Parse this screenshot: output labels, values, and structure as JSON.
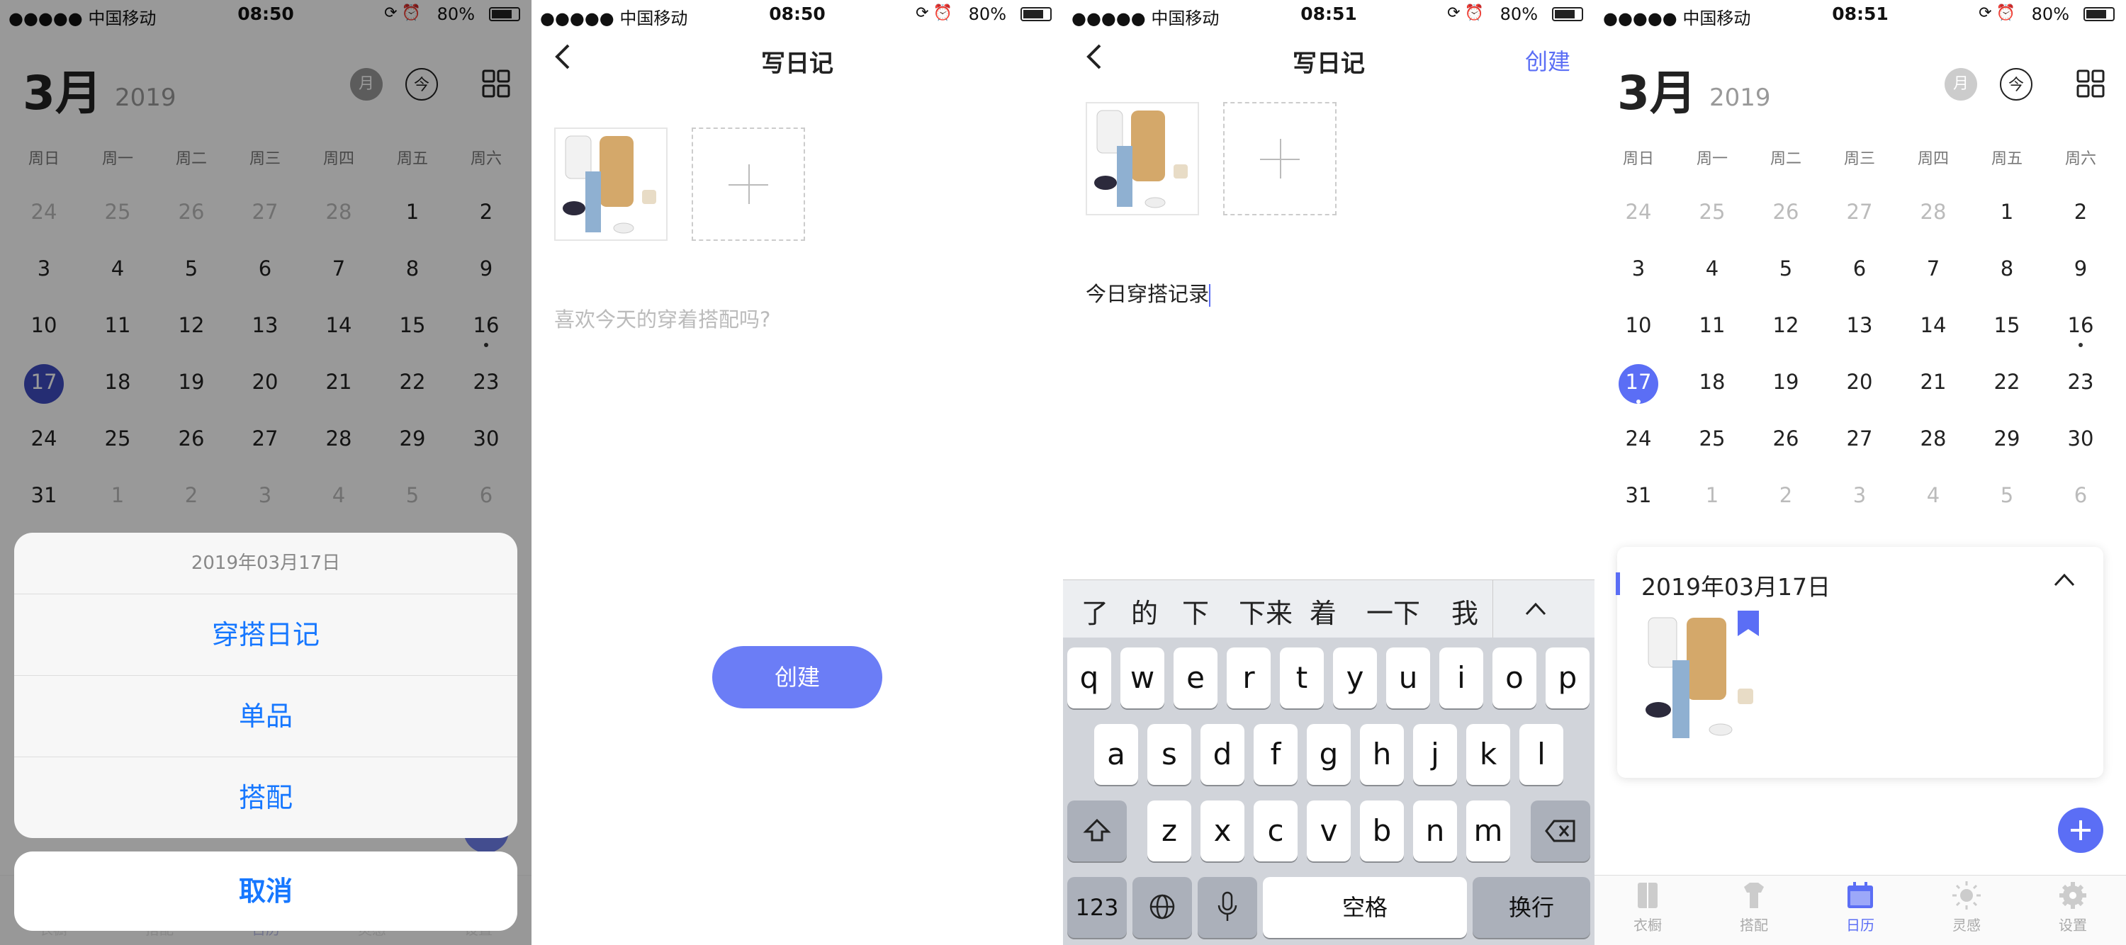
{
  "status": {
    "carrier": "●●●●● 中国移动",
    "time_1": "08:50",
    "time_2": "08:50",
    "time_3": "08:51",
    "time_4": "08:51",
    "battery": "80%"
  },
  "calendar": {
    "month": "3月",
    "year": "2019",
    "month_toggle": "月",
    "today_btn": "今",
    "weekdays": [
      "周日",
      "周一",
      "周二",
      "周三",
      "周四",
      "周五",
      "周六"
    ],
    "days": [
      [
        "24",
        "25",
        "26",
        "27",
        "28",
        "1",
        "2"
      ],
      [
        "3",
        "4",
        "5",
        "6",
        "7",
        "8",
        "9"
      ],
      [
        "10",
        "11",
        "12",
        "13",
        "14",
        "15",
        "16"
      ],
      [
        "17",
        "18",
        "19",
        "20",
        "21",
        "22",
        "23"
      ],
      [
        "24",
        "25",
        "26",
        "27",
        "28",
        "29",
        "30"
      ],
      [
        "31",
        "1",
        "2",
        "3",
        "4",
        "5",
        "6"
      ]
    ],
    "selected_day": "17"
  },
  "sheet": {
    "title": "2019年03月17日",
    "options": [
      "穿搭日记",
      "单品",
      "搭配"
    ],
    "cancel": "取消"
  },
  "bottom_faded": [
    "衣橱",
    "搭配",
    "日历",
    "灵感",
    "设置"
  ],
  "diary": {
    "title": "写日记",
    "placeholder": "喜欢今天的穿着搭配吗?",
    "create_button": "创建",
    "nav_create": "创建",
    "typed_text": "今日穿搭记录"
  },
  "keyboard": {
    "predictions": [
      "了",
      "的",
      "下",
      "下来",
      "着",
      "一下",
      "我"
    ],
    "row1": [
      "q",
      "w",
      "e",
      "r",
      "t",
      "y",
      "u",
      "i",
      "o",
      "p"
    ],
    "row2": [
      "a",
      "s",
      "d",
      "f",
      "g",
      "h",
      "j",
      "k",
      "l"
    ],
    "row3": [
      "z",
      "x",
      "c",
      "v",
      "b",
      "n",
      "m"
    ],
    "num_key": "123",
    "space": "空格",
    "return": "换行"
  },
  "entry": {
    "date": "2019年03月17日"
  },
  "tabs": [
    "衣橱",
    "搭配",
    "日历",
    "灵感",
    "设置"
  ],
  "colors": {
    "accent": "#5b6ef5",
    "selected_dark": "#3f4bc0",
    "sheet_link": "#1677ff"
  }
}
